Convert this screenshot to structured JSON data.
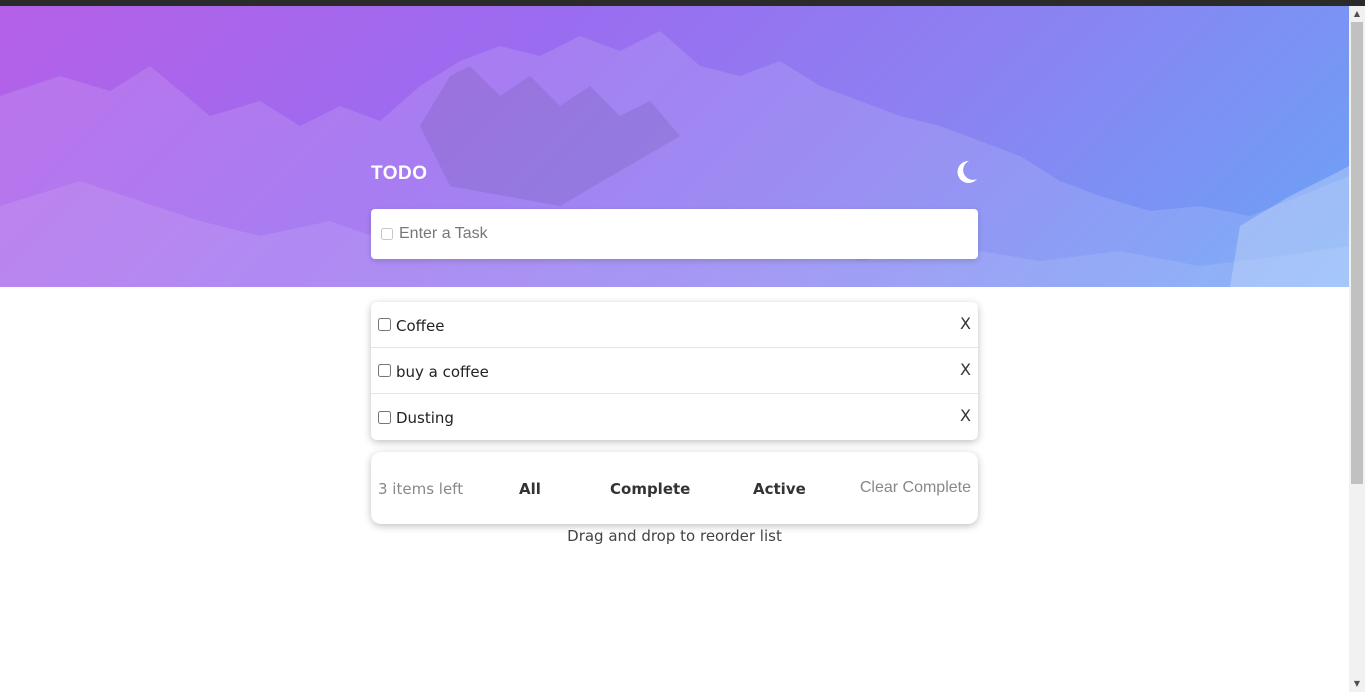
{
  "header": {
    "title": "TODO",
    "theme_icon": "moon-icon"
  },
  "new_task": {
    "placeholder": "Enter a Task"
  },
  "todos": [
    {
      "text": "Coffee",
      "completed": false,
      "delete_label": "X"
    },
    {
      "text": "buy a coffee",
      "completed": false,
      "delete_label": "X"
    },
    {
      "text": "Dusting",
      "completed": false,
      "delete_label": "X"
    }
  ],
  "footer": {
    "items_left": "3 items left",
    "filters": [
      "All",
      "Complete",
      "Active"
    ],
    "clear_label": "Clear Complete"
  },
  "hint": "Drag and drop to reorder list",
  "colors": {
    "gradient_start": "#b560e8",
    "gradient_end": "#6aa4f6"
  }
}
